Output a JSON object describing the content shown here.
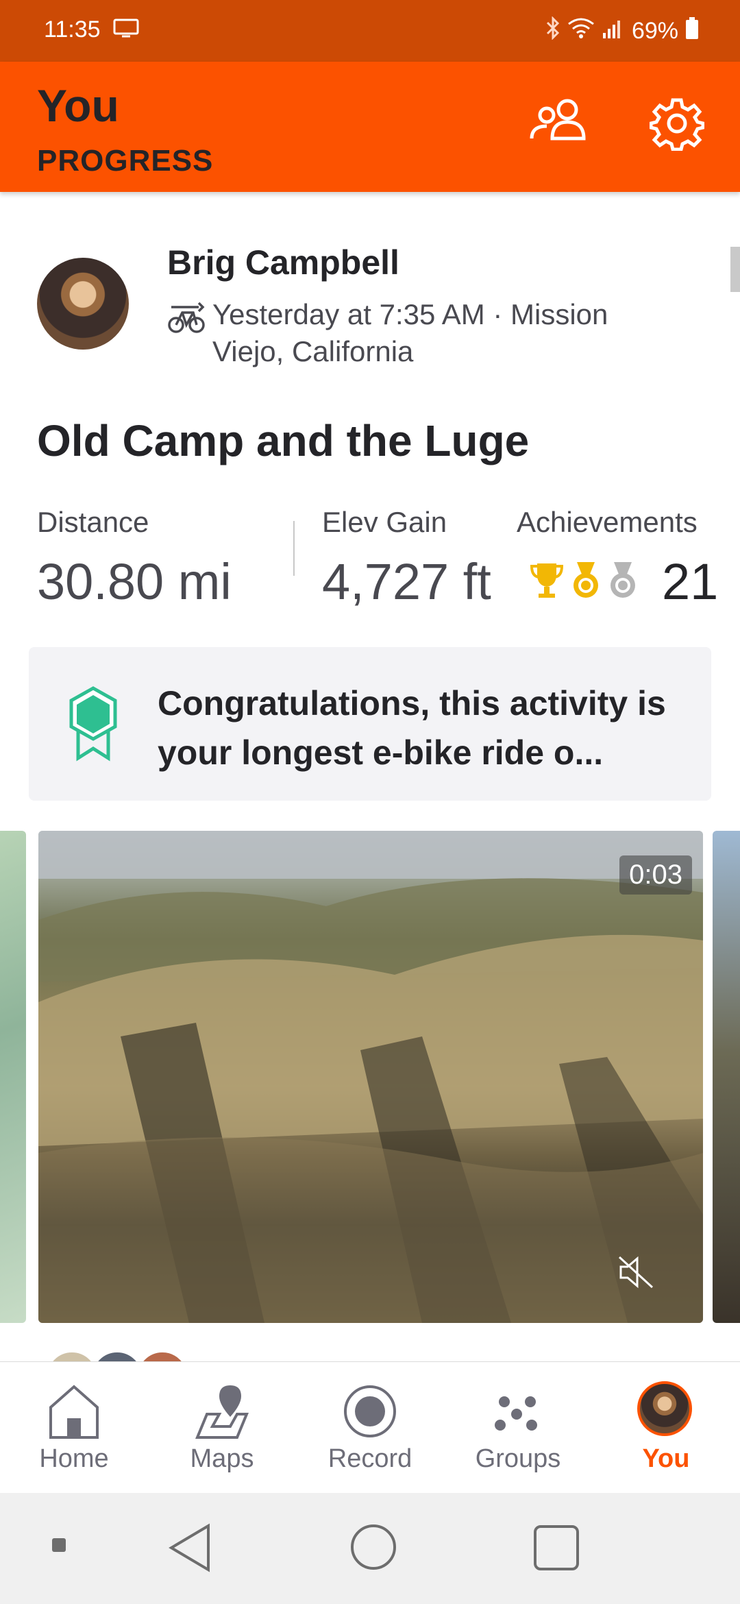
{
  "status_bar": {
    "time": "11:35",
    "battery": "69%",
    "icons": [
      "cast-icon",
      "bluetooth-icon",
      "wifi-icon",
      "signal-icon",
      "battery-icon"
    ]
  },
  "header": {
    "title": "You",
    "subtitle": "PROGRESS",
    "actions": [
      "people-icon",
      "gear-icon"
    ]
  },
  "activity": {
    "athlete_name": "Brig Campbell",
    "activity_icon": "ebike-icon",
    "meta": "Yesterday at 7:35 AM · Mission Viejo, California",
    "title": "Old Camp and the Luge",
    "stats": {
      "distance_label": "Distance",
      "distance_value": "30.80 mi",
      "elev_label": "Elev Gain",
      "elev_value": "4,727 ft",
      "achievements_label": "Achievements",
      "achievements_count": "21"
    },
    "banner_text": "Congratulations, this activity is your longest e-bike ride o...",
    "video_duration": "0:03"
  },
  "bottom_nav": {
    "items": [
      {
        "label": "Home",
        "icon": "home-icon"
      },
      {
        "label": "Maps",
        "icon": "map-pin-icon"
      },
      {
        "label": "Record",
        "icon": "record-icon"
      },
      {
        "label": "Groups",
        "icon": "groups-icon"
      },
      {
        "label": "You",
        "icon": "avatar"
      }
    ],
    "active": "You"
  },
  "colors": {
    "brand": "#fc5200",
    "status_bar": "#cc4a05",
    "achievement_green": "#2ebf91",
    "gold": "#f2b705",
    "silver": "#b5b5b5"
  }
}
